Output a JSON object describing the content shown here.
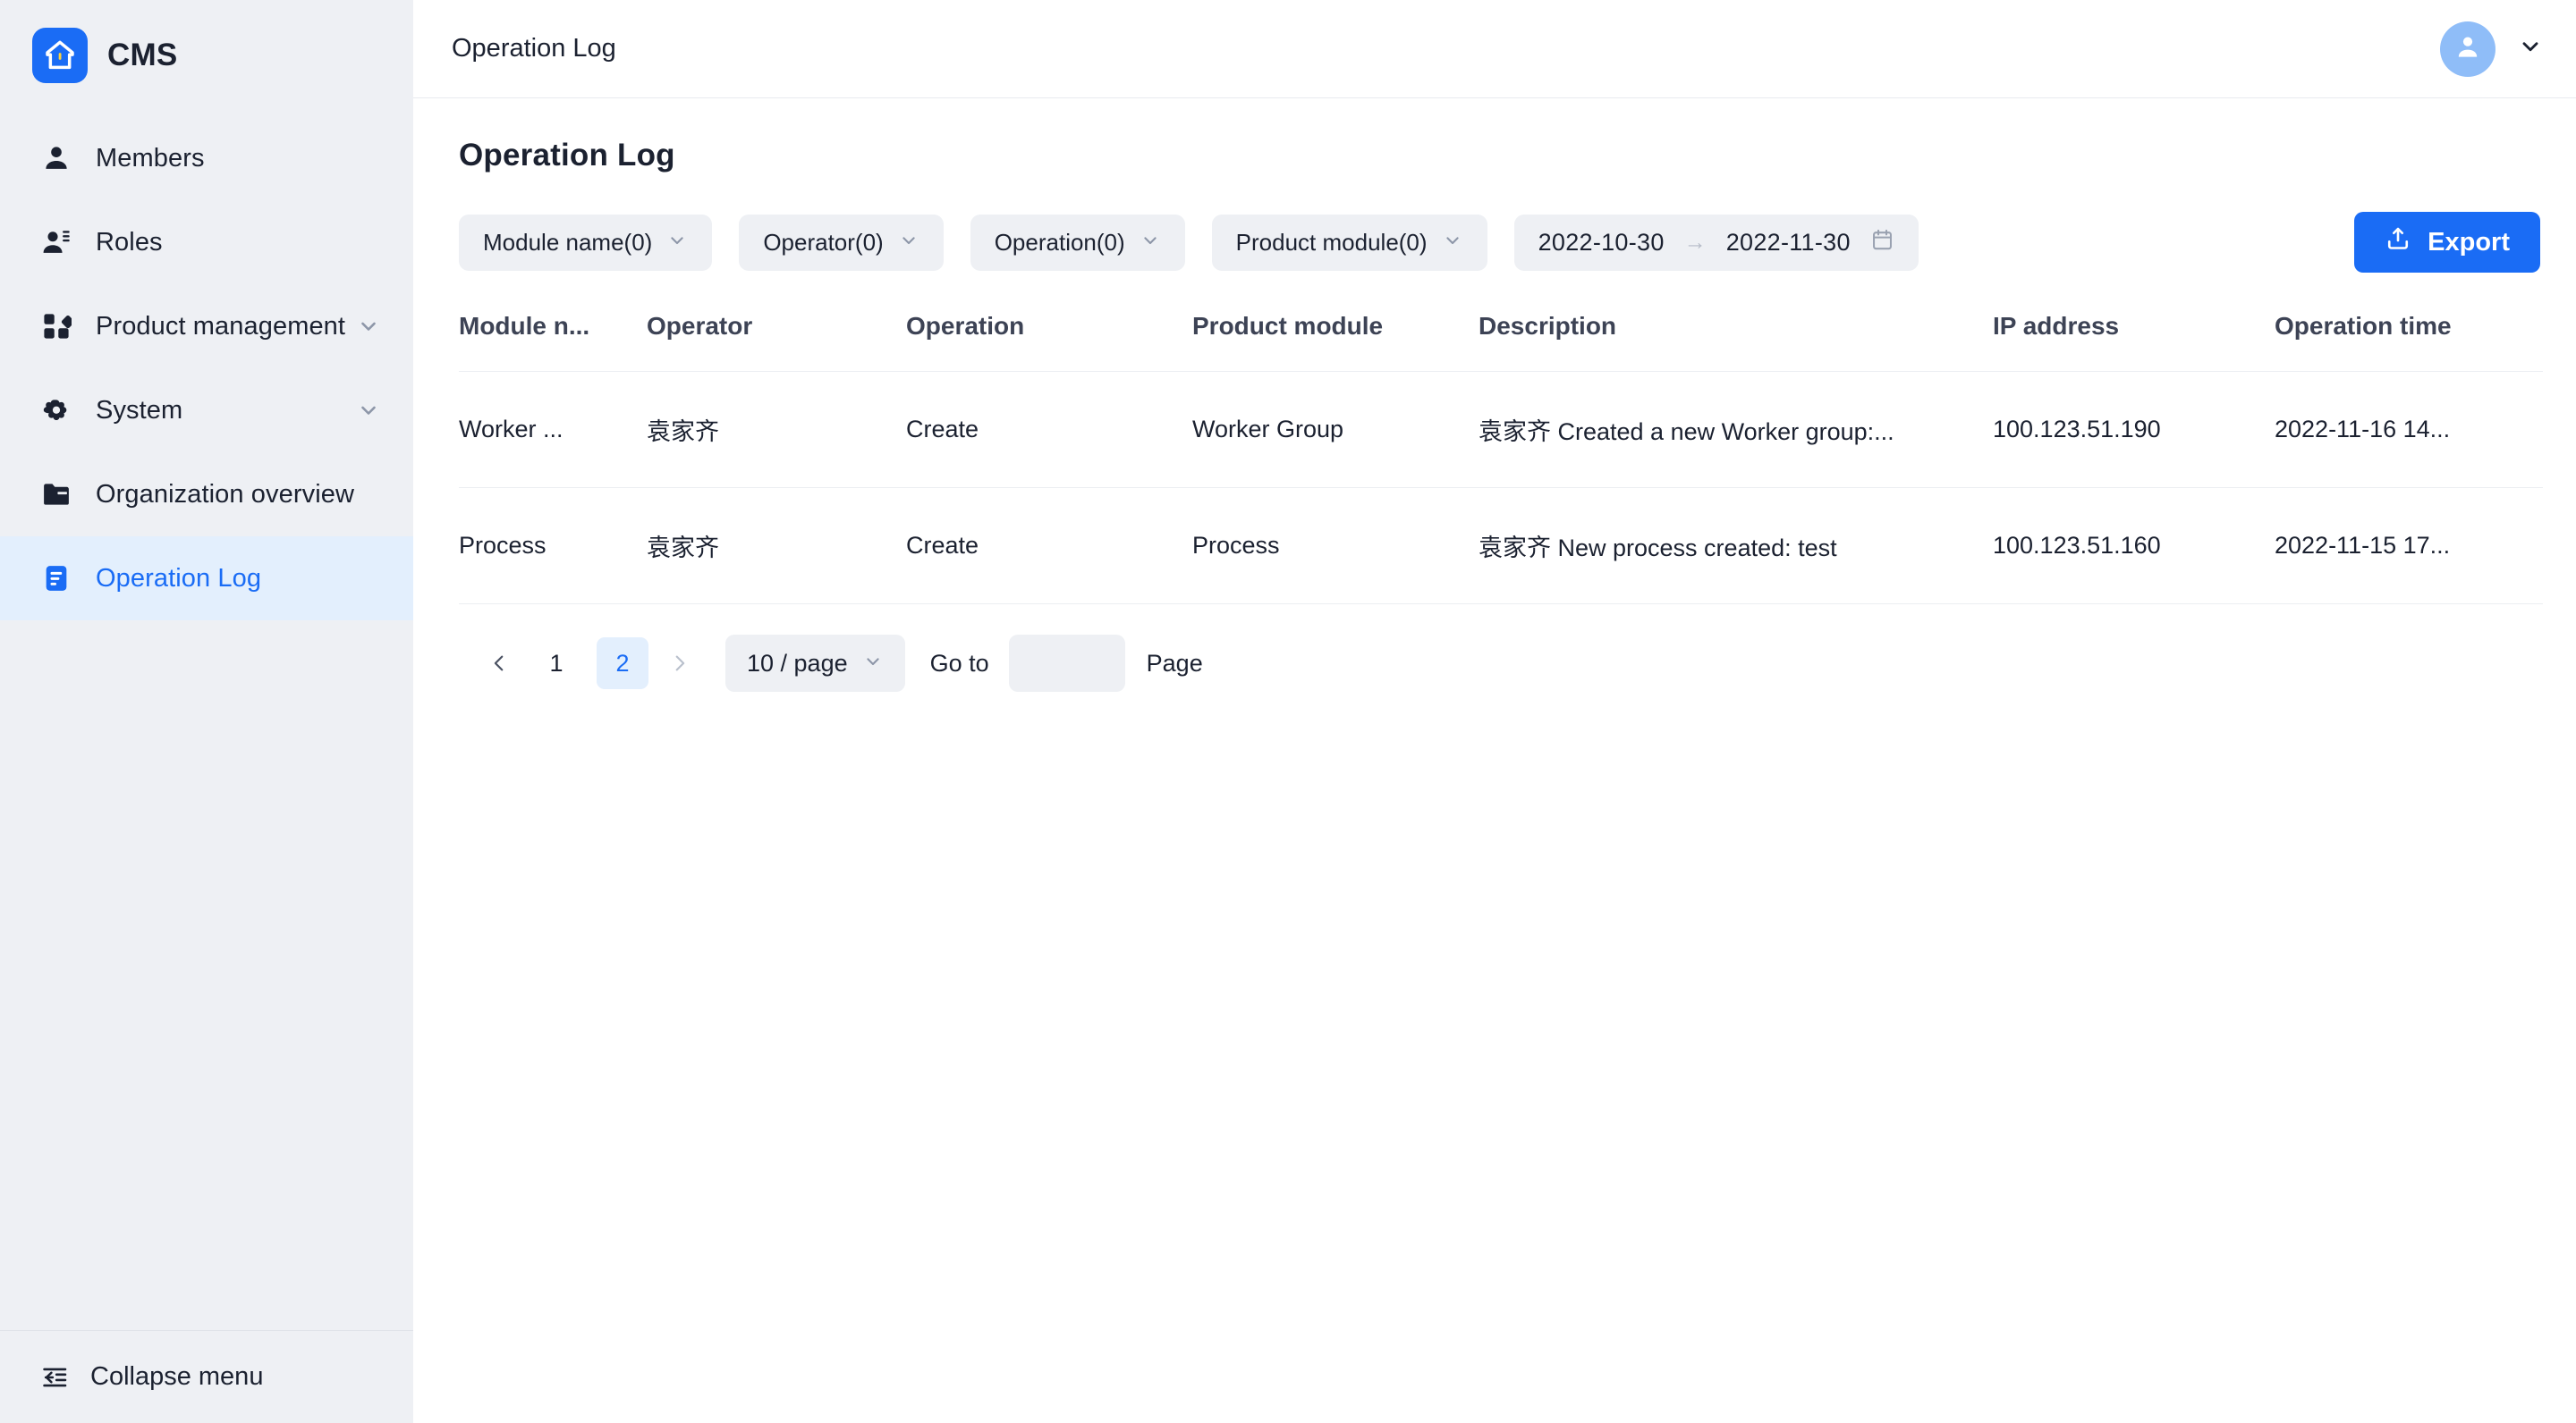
{
  "brand": {
    "name": "CMS",
    "logo_icon": "home-logo-icon"
  },
  "sidebar": {
    "items": [
      {
        "label": "Members",
        "icon": "person-icon",
        "expandable": false,
        "active": false
      },
      {
        "label": "Roles",
        "icon": "person-list-icon",
        "expandable": false,
        "active": false
      },
      {
        "label": "Product management",
        "icon": "grid-blocks-icon",
        "expandable": true,
        "active": false
      },
      {
        "label": "System",
        "icon": "gear-icon",
        "expandable": true,
        "active": false
      },
      {
        "label": "Organization overview",
        "icon": "folder-icon",
        "expandable": false,
        "active": false
      },
      {
        "label": "Operation Log",
        "icon": "document-lines-icon",
        "expandable": false,
        "active": true
      }
    ],
    "collapse": {
      "label": "Collapse menu",
      "icon": "collapse-menu-icon"
    }
  },
  "topbar": {
    "breadcrumb": "Operation Log",
    "avatar_icon": "user-avatar-icon",
    "chevron_icon": "chevron-down-icon"
  },
  "main": {
    "page_title": "Operation Log",
    "filters": [
      {
        "label": "Module name(0)",
        "count": 0
      },
      {
        "label": "Operator(0)",
        "count": 0
      },
      {
        "label": "Operation(0)",
        "count": 0
      },
      {
        "label": "Product module(0)",
        "count": 0
      }
    ],
    "date_range": {
      "start": "2022-10-30",
      "end": "2022-11-30",
      "separator": "→",
      "calendar_icon": "calendar-icon"
    },
    "export_button": {
      "label": "Export",
      "icon": "export-upload-icon"
    },
    "table": {
      "columns": [
        "Module n...",
        "Operator",
        "Operation",
        "Product module",
        "Description",
        "IP address",
        "Operation time"
      ],
      "rows": [
        {
          "module_name": "Worker ...",
          "operator": "袁家齐",
          "operation": "Create",
          "product_module": "Worker Group",
          "description": "袁家齐 Created a new Worker group:...",
          "ip_address": "100.123.51.190",
          "operation_time": "2022-11-16 14..."
        },
        {
          "module_name": "Process",
          "operator": "袁家齐",
          "operation": "Create",
          "product_module": "Process",
          "description": "袁家齐 New process created: test",
          "ip_address": "100.123.51.160",
          "operation_time": "2022-11-15 17..."
        }
      ]
    },
    "pagination": {
      "prev_icon": "chevron-left-icon",
      "next_icon": "chevron-right-icon",
      "pages": [
        "1",
        "2"
      ],
      "current_page": "2",
      "page_size_label": "10 / page",
      "goto_label": "Go to",
      "goto_value": "",
      "page_suffix": "Page"
    }
  },
  "colors": {
    "accent": "#1a6cf5",
    "sidebar_bg": "#eef0f4",
    "active_bg": "#e3effd",
    "text": "#1b2130",
    "avatar_bg": "#8fbdf8"
  }
}
